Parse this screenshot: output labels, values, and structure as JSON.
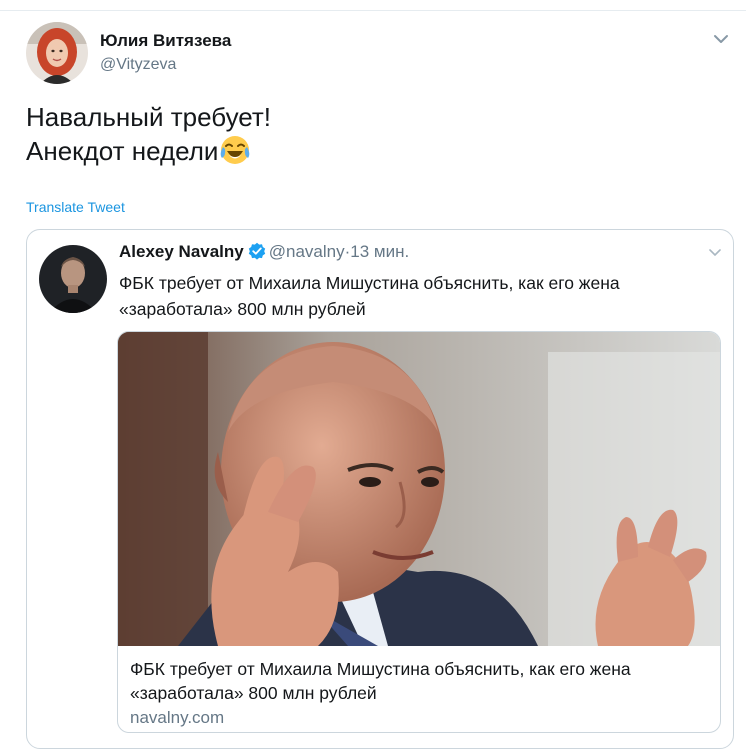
{
  "tweet": {
    "author_name": "Юлия Витязева",
    "author_handle": "@Vityzeva",
    "text_lines": [
      "Навальный требует!",
      "Анекдот недели"
    ],
    "emoji": "face-with-tears-of-joy",
    "translate_label": "Translate Tweet"
  },
  "quoted_tweet": {
    "author_name": "Alexey Navalny",
    "verified": true,
    "author_handle": "@navalny",
    "separator": "·",
    "time": "13 мин.",
    "text_lines": [
      "ФБК требует от Михаила Мишустина объяснить, как его жена",
      "«заработала» 800 млн рублей"
    ],
    "card": {
      "title_lines": [
        "ФБК требует от Михаила Мишустина объяснить, как его жена",
        "«заработала» 800 млн рублей"
      ],
      "domain": "navalny.com"
    }
  },
  "colors": {
    "text": "#14171a",
    "secondary": "#657786",
    "link": "#1b95e0",
    "border": "#ccd6dd",
    "verified": "#1da1f2"
  }
}
